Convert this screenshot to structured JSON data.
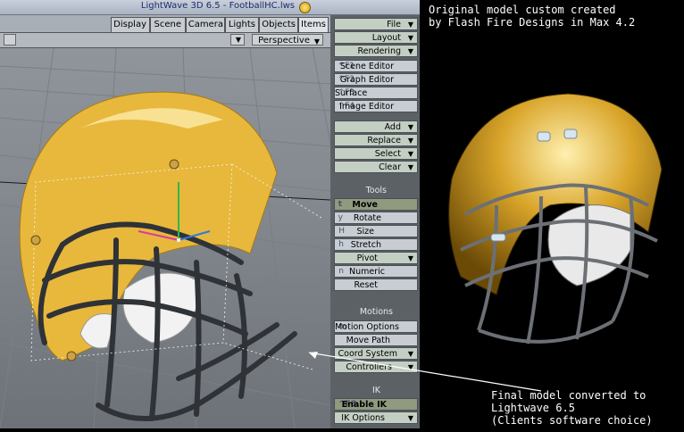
{
  "window": {
    "title": "LightWave 3D 6.5 - FootballHC.lws"
  },
  "tabs": [
    {
      "label": "Items"
    },
    {
      "label": "Objects"
    },
    {
      "label": "Lights"
    },
    {
      "label": "Camera"
    },
    {
      "label": "Scene"
    },
    {
      "label": "Display"
    }
  ],
  "viewport": {
    "view_mode": "Perspective"
  },
  "toolbar": {
    "menus": [
      {
        "label": "File"
      },
      {
        "label": "Layout"
      },
      {
        "label": "Rendering"
      }
    ],
    "editors": [
      {
        "label": "Scene Editor",
        "key": "^F1"
      },
      {
        "label": "Graph Editor",
        "key": "^F2"
      },
      {
        "label": "Surface Editor",
        "key": "^F3"
      },
      {
        "label": "Image Editor",
        "key": "^F4"
      }
    ],
    "menus2": [
      {
        "label": "Add"
      },
      {
        "label": "Replace"
      },
      {
        "label": "Select"
      },
      {
        "label": "Clear"
      }
    ],
    "tools_header": "Tools",
    "tools": [
      {
        "label": "Move",
        "key": "t"
      },
      {
        "label": "Rotate",
        "key": "y"
      },
      {
        "label": "Size",
        "key": "H"
      },
      {
        "label": "Stretch",
        "key": "h"
      },
      {
        "label": "Pivot",
        "key": ""
      },
      {
        "label": "Numeric",
        "key": "n"
      },
      {
        "label": "Reset",
        "key": ""
      }
    ],
    "motions_header": "Motions",
    "motions": [
      {
        "label": "Motion Options",
        "key": "m"
      },
      {
        "label": "Move Path",
        "key": ""
      },
      {
        "label": "Coord System",
        "key": ""
      },
      {
        "label": "Controllers",
        "key": ""
      }
    ],
    "ik_header": "IK",
    "ik": [
      {
        "label": "Enable IK",
        "key": "^F8"
      },
      {
        "label": "IK Options",
        "key": ""
      }
    ]
  },
  "annotations": {
    "top": [
      "Original model custom created",
      "by Flash Fire Designs in Max 4.2"
    ],
    "bottom": [
      "Final model converted to",
      "Lightwave 6.5",
      "(Clients software choice)"
    ]
  },
  "colors": {
    "helmet_yellow": "#e7b93a",
    "facemask": "#2f3236",
    "background": "#000000"
  }
}
